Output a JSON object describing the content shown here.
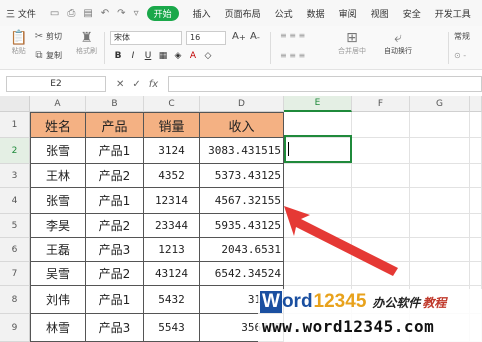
{
  "menu": {
    "file": "三 文件",
    "start": "开始",
    "tabs": [
      "插入",
      "页面布局",
      "公式",
      "数据",
      "审阅",
      "视图",
      "安全",
      "开发工具"
    ]
  },
  "ribbon": {
    "cut": "剪切",
    "paste": "粘贴",
    "copy": "复制",
    "format_painter": "格式刷",
    "font": "宋体",
    "size": "16",
    "merge_center": "合并居中",
    "wrap": "自动换行",
    "normal": "常规"
  },
  "formula_bar": {
    "cell_ref": "E2",
    "fx": "fx"
  },
  "columns": [
    "A",
    "B",
    "C",
    "D",
    "E",
    "F",
    "G"
  ],
  "rows": [
    "1",
    "2",
    "3",
    "4",
    "5",
    "6",
    "7",
    "8",
    "9"
  ],
  "table": {
    "headers": [
      "姓名",
      "产品",
      "销量",
      "收入"
    ],
    "data": [
      [
        "张雪",
        "产品1",
        "3124",
        "3083.431515"
      ],
      [
        "王林",
        "产品2",
        "4352",
        "5373.43125"
      ],
      [
        "张雪",
        "产品1",
        "12314",
        "4567.32155"
      ],
      [
        "李昊",
        "产品2",
        "23344",
        "5935.43125"
      ],
      [
        "王磊",
        "产品3",
        "1213",
        "2043.6531"
      ],
      [
        "吴雪",
        "产品2",
        "43124",
        "6542.34524"
      ],
      [
        "刘伟",
        "产品1",
        "5432",
        "3123."
      ],
      [
        "林雪",
        "产品3",
        "5543",
        "3567.8"
      ]
    ]
  },
  "watermark": {
    "w": "W",
    "ord": "ord",
    "num": "12345",
    "cn1": "办公软件",
    "cn2": "教程",
    "url": "www.word12345.com"
  },
  "colors": {
    "header_fill": "#f4b183",
    "selection": "#1f8a3b",
    "arrow": "#e53935"
  }
}
